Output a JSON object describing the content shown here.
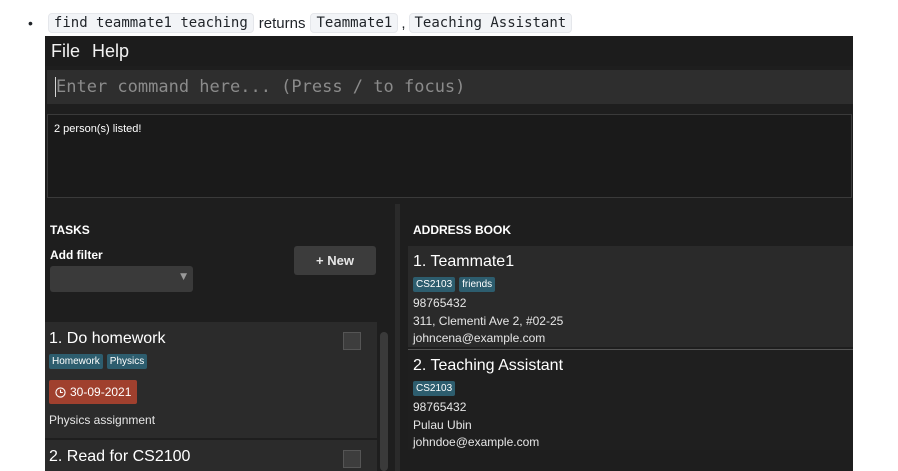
{
  "doc": {
    "bullet": "•",
    "command": "find teammate1 teaching",
    "returns_text": "returns",
    "result_a": "Teammate1",
    "comma": ",",
    "result_b": "Teaching Assistant"
  },
  "menu": {
    "file": "File",
    "help": "Help"
  },
  "command_box": {
    "placeholder": "Enter command here... (Press / to focus)"
  },
  "result_display": {
    "text": "2 person(s) listed!"
  },
  "tasks": {
    "title": "TASKS",
    "filter_label": "Add filter",
    "filter_icon": "chevron-down-icon",
    "new_button": "+ New",
    "items": [
      {
        "name": "1.  Do homework",
        "tags": [
          "Homework",
          "Physics"
        ],
        "date": "30-09-2021",
        "date_icon": "clock-icon",
        "description": "Physics assignment",
        "done": false
      },
      {
        "name": "2.  Read for CS2100",
        "done": false
      }
    ]
  },
  "address_book": {
    "title": "ADDRESS BOOK",
    "persons": [
      {
        "name": "1.  Teammate1",
        "tags": [
          "CS2103",
          "friends"
        ],
        "phone": "98765432",
        "address": "311, Clementi Ave 2, #02-25",
        "email": "johncena@example.com"
      },
      {
        "name": "2.  Teaching Assistant",
        "tags": [
          "CS2103"
        ],
        "phone": "98765432",
        "address": "Pulau Ubin",
        "email": "johndoe@example.com"
      }
    ]
  },
  "colors": {
    "app_bg": "#1e1e1e",
    "card_bg": "#2b2b2b",
    "tag_bg": "#2d5d6e",
    "date_badge_bg": "#a0402e"
  }
}
